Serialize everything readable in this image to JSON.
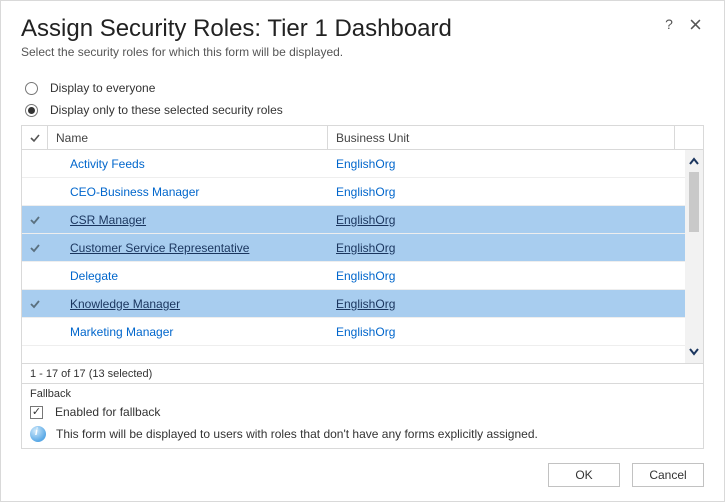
{
  "title": "Assign Security Roles: Tier 1 Dashboard",
  "subtitle": "Select the security roles for which this form will be displayed.",
  "radios": {
    "everyone": "Display to everyone",
    "selected": "Display only to these selected security roles"
  },
  "columns": {
    "name": "Name",
    "bu": "Business Unit"
  },
  "rows": [
    {
      "name": "Activity Feeds",
      "bu": "EnglishOrg",
      "selected": false
    },
    {
      "name": "CEO-Business Manager",
      "bu": "EnglishOrg",
      "selected": false
    },
    {
      "name": "CSR Manager",
      "bu": "EnglishOrg",
      "selected": true
    },
    {
      "name": "Customer Service Representative",
      "bu": "EnglishOrg",
      "selected": true
    },
    {
      "name": "Delegate",
      "bu": "EnglishOrg",
      "selected": false
    },
    {
      "name": "Knowledge Manager",
      "bu": "EnglishOrg",
      "selected": true
    },
    {
      "name": "Marketing Manager",
      "bu": "EnglishOrg",
      "selected": false
    }
  ],
  "pager": "1 - 17 of 17 (13 selected)",
  "fallback": {
    "heading": "Fallback",
    "checkbox": "Enabled for fallback",
    "info": "This form will be displayed to users with roles that don't have any forms explicitly assigned."
  },
  "buttons": {
    "ok": "OK",
    "cancel": "Cancel"
  }
}
